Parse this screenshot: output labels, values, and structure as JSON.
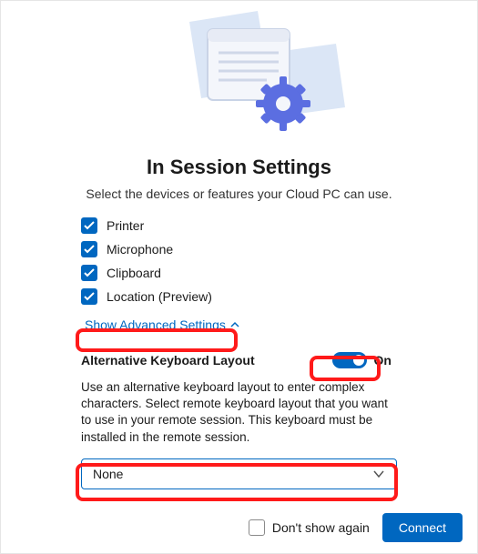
{
  "title": "In Session Settings",
  "subtitle": "Select the devices or features your Cloud PC can use.",
  "devices": {
    "printer": "Printer",
    "microphone": "Microphone",
    "clipboard": "Clipboard",
    "location": "Location (Preview)"
  },
  "advanced_link": "Show Advanced Settings",
  "alt_kb": {
    "heading": "Alternative Keyboard Layout",
    "toggle_label": "On",
    "description": "Use an alternative keyboard layout to enter complex characters. Select remote keyboard layout that you want to use in your remote session. This keyboard must be installed in the remote session.",
    "selected": "None"
  },
  "footer": {
    "dont_show": "Don't show again",
    "connect": "Connect"
  },
  "icons": {
    "check": "check-icon",
    "chevron_up": "chevron-up-icon",
    "chevron_down": "chevron-down-icon"
  },
  "colors": {
    "accent": "#0067c0",
    "highlight": "#ff1a1a"
  }
}
